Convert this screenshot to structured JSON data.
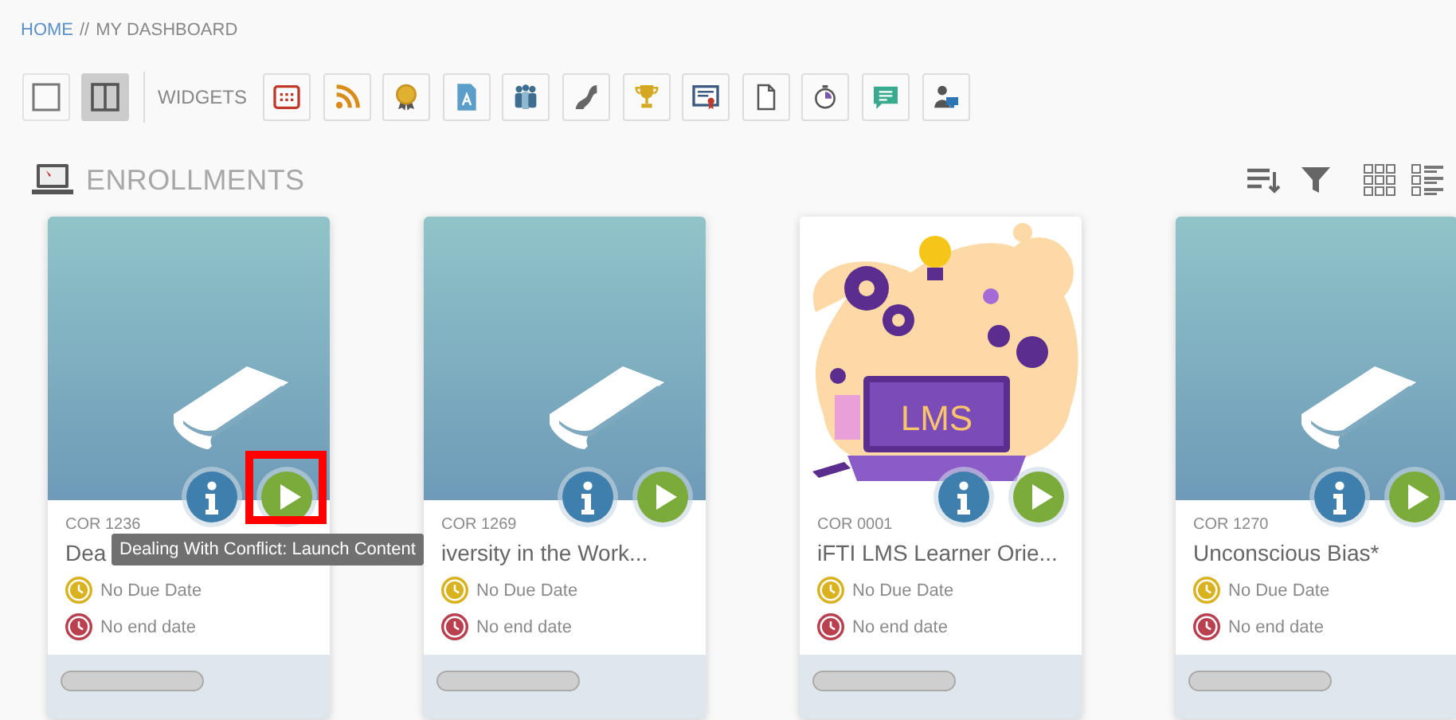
{
  "breadcrumb": {
    "home": "HOME",
    "separator": "//",
    "current": "MY DASHBOARD"
  },
  "layout_options": [
    {
      "selected": false
    },
    {
      "selected": true
    }
  ],
  "widgets_label": "WIDGETS",
  "section": {
    "title": "ENROLLMENTS"
  },
  "cards": [
    {
      "kind": "book",
      "code": "COR 1236",
      "title": "Dea",
      "due": "No Due Date",
      "end": "No end date",
      "highlighted": true,
      "tooltip": "Dealing With Conflict: Launch Content"
    },
    {
      "kind": "book",
      "code": "COR 1269",
      "title": "iversity in the Work...",
      "due": "No Due Date",
      "end": "No end date",
      "highlighted": false
    },
    {
      "kind": "illustration",
      "image_text": "LMS",
      "code": "COR 0001",
      "title": "iFTI LMS Learner Orie...",
      "due": "No Due Date",
      "end": "No end date",
      "highlighted": false
    },
    {
      "kind": "book",
      "code": "COR 1270",
      "title": "Unconscious Bias*",
      "due": "No Due Date",
      "end": "No end date",
      "highlighted": false
    }
  ]
}
